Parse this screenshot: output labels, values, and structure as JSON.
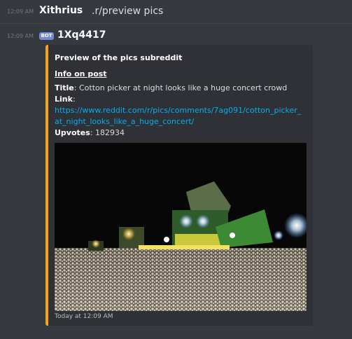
{
  "message1": {
    "timestamp": "12:09 AM",
    "author": "Xithrius",
    "content": ".r/preview pics"
  },
  "message2": {
    "timestamp": "12:09 AM",
    "badge": "BOT",
    "author": "1Xq4417"
  },
  "embed": {
    "accent_color": "#f2a518",
    "title": "Preview of the pics subreddit",
    "section_title": "Info on post",
    "title_label": "Title",
    "title_value": ": Cotton picker at night looks like a huge concert crowd",
    "link_label": "Link",
    "link_sep": ":",
    "link_line1": "https://www.reddit.com/r/pics/comments/7ag091/cotton_picker_",
    "link_line2": "at_night_looks_like_a_huge_concert/",
    "upvotes_label": "Upvotes",
    "upvotes_value": ": 182934",
    "footer": "Today at 12:09 AM"
  }
}
